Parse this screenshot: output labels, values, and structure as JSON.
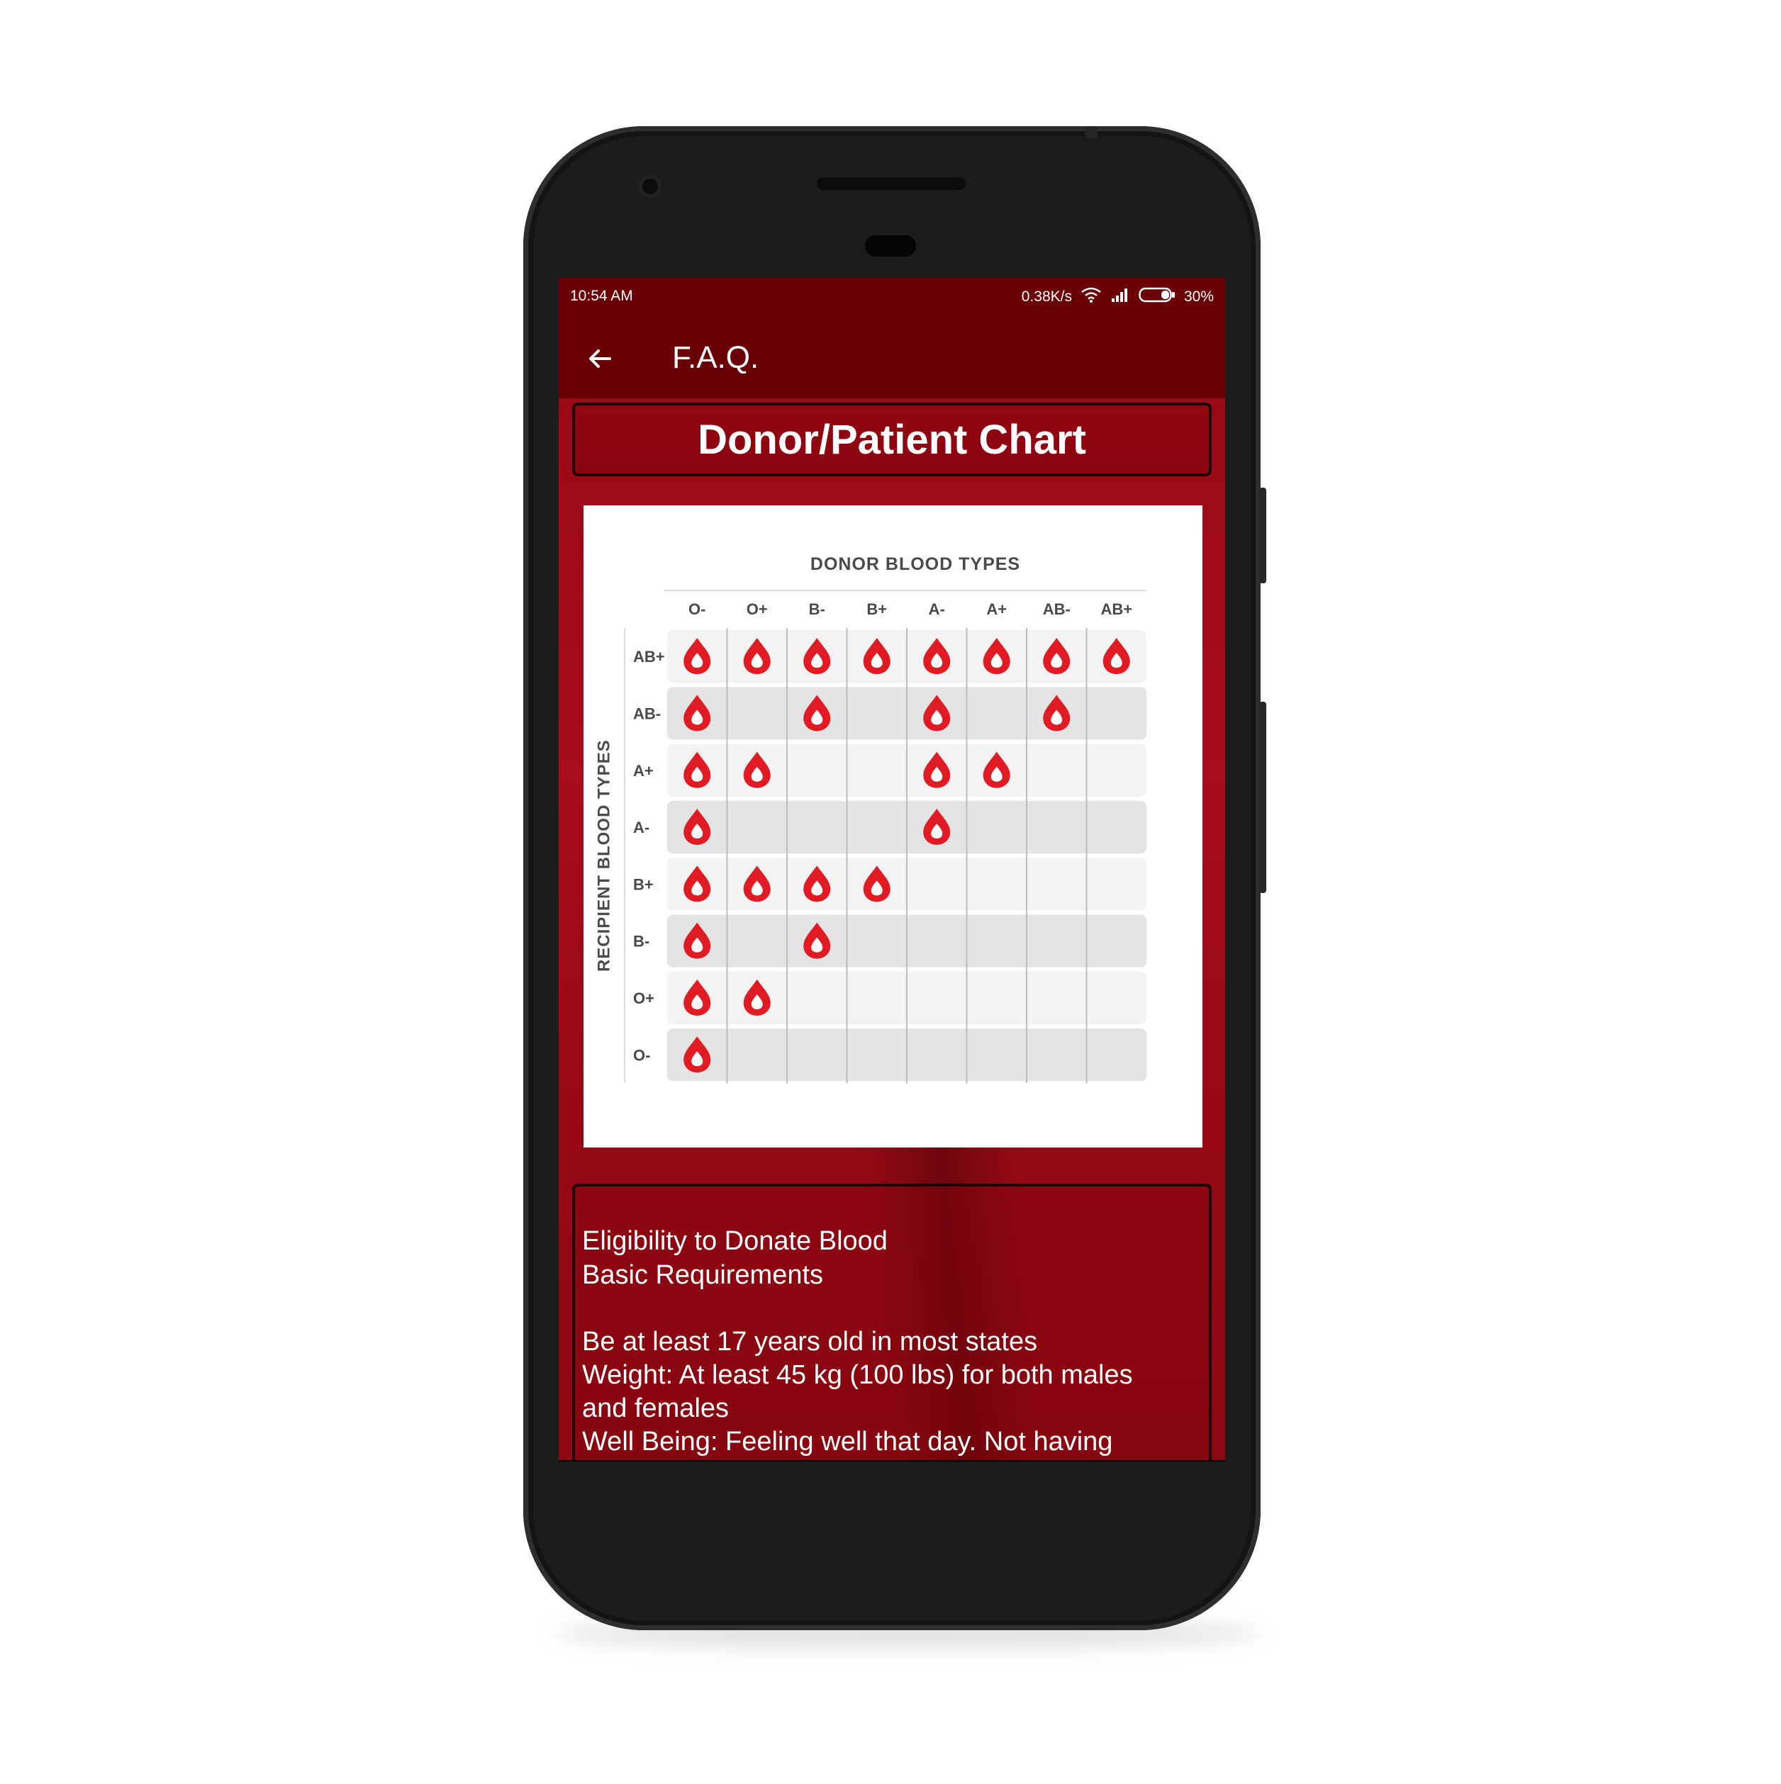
{
  "status_bar": {
    "time": "10:54 AM",
    "network_speed": "0.38K/s",
    "battery": "30%"
  },
  "toolbar": {
    "title": "F.A.Q.",
    "back_icon": "arrow-left-icon"
  },
  "chart_banner": {
    "title": "Donor/Patient Chart"
  },
  "chart_data": {
    "type": "table",
    "title": "",
    "column_axis_label": "DONOR BLOOD TYPES",
    "row_axis_label": "RECIPIENT BLOOD TYPES",
    "columns": [
      "O-",
      "O+",
      "B-",
      "B+",
      "A-",
      "A+",
      "AB-",
      "AB+"
    ],
    "rows": [
      "AB+",
      "AB-",
      "A+",
      "A-",
      "B+",
      "B-",
      "O+",
      "O-"
    ],
    "compatible": [
      [
        1,
        1,
        1,
        1,
        1,
        1,
        1,
        1
      ],
      [
        1,
        0,
        1,
        0,
        1,
        0,
        1,
        0
      ],
      [
        1,
        1,
        0,
        0,
        1,
        1,
        0,
        0
      ],
      [
        1,
        0,
        0,
        0,
        1,
        0,
        0,
        0
      ],
      [
        1,
        1,
        1,
        1,
        0,
        0,
        0,
        0
      ],
      [
        1,
        0,
        1,
        0,
        0,
        0,
        0,
        0
      ],
      [
        1,
        1,
        0,
        0,
        0,
        0,
        0,
        0
      ],
      [
        1,
        0,
        0,
        0,
        0,
        0,
        0,
        0
      ]
    ],
    "marker_icon": "blood-drop-icon",
    "colors": {
      "drop": "#e01b23",
      "row_light": "#f3f3f3",
      "row_dark": "#e4e4e4",
      "label": "#4a4a4a"
    }
  },
  "info": {
    "lines": [
      "Eligibility to Donate Blood",
      "Basic Requirements",
      "",
      "Be at least 17 years old in most states",
      "Weight: At least 45 kg (100 lbs) for both males",
      "and females",
      "Well Being: Feeling well that day. Not having"
    ]
  },
  "colors": {
    "appbar": "#6a0006",
    "accent": "#a70d1c"
  }
}
